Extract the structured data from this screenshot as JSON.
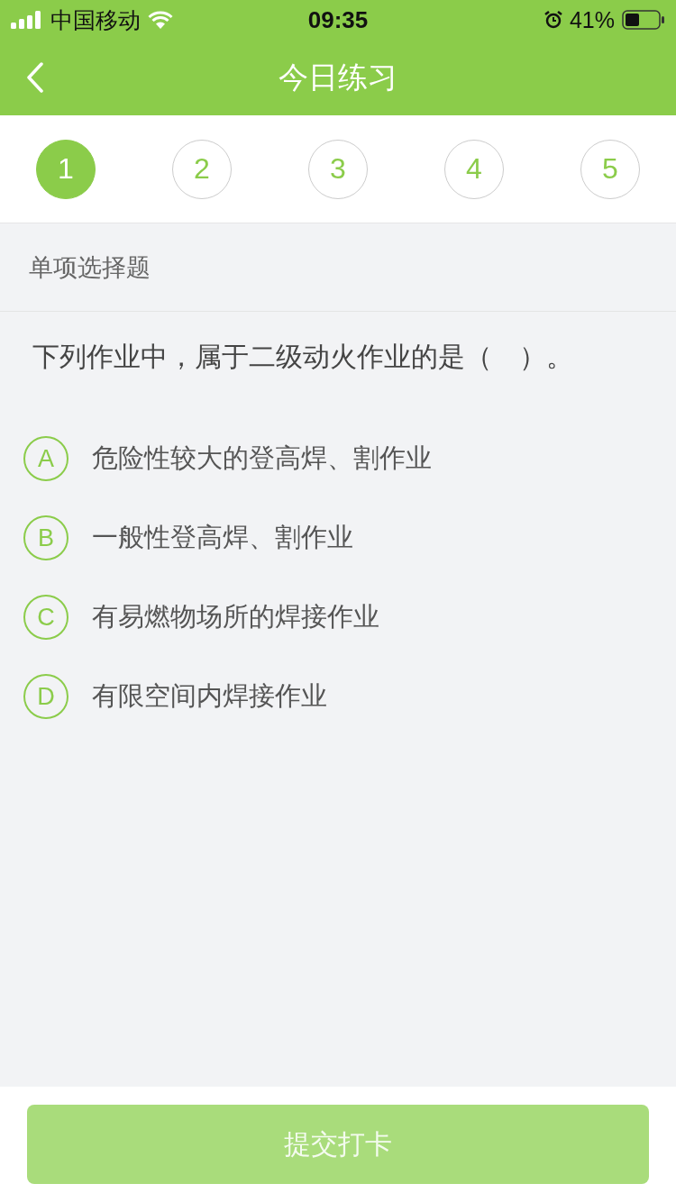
{
  "status_bar": {
    "carrier": "中国移动",
    "time": "09:35",
    "battery": "41%"
  },
  "nav": {
    "title": "今日练习"
  },
  "steps": [
    {
      "label": "1",
      "selected": true
    },
    {
      "label": "2",
      "selected": false
    },
    {
      "label": "3",
      "selected": false
    },
    {
      "label": "4",
      "selected": false
    },
    {
      "label": "5",
      "selected": false
    }
  ],
  "question_type": "单项选择题",
  "question": "下列作业中，属于二级动火作业的是（　）。",
  "options": [
    {
      "letter": "A",
      "text": "危险性较大的登高焊、割作业",
      "selected": false
    },
    {
      "letter": "B",
      "text": "一般性登高焊、割作业",
      "selected": false
    },
    {
      "letter": "C",
      "text": "有易燃物场所的焊接作业",
      "selected": false
    },
    {
      "letter": "D",
      "text": "有限空间内焊接作业",
      "selected": false
    }
  ],
  "submit": {
    "label": "提交打卡",
    "disabled": true
  }
}
